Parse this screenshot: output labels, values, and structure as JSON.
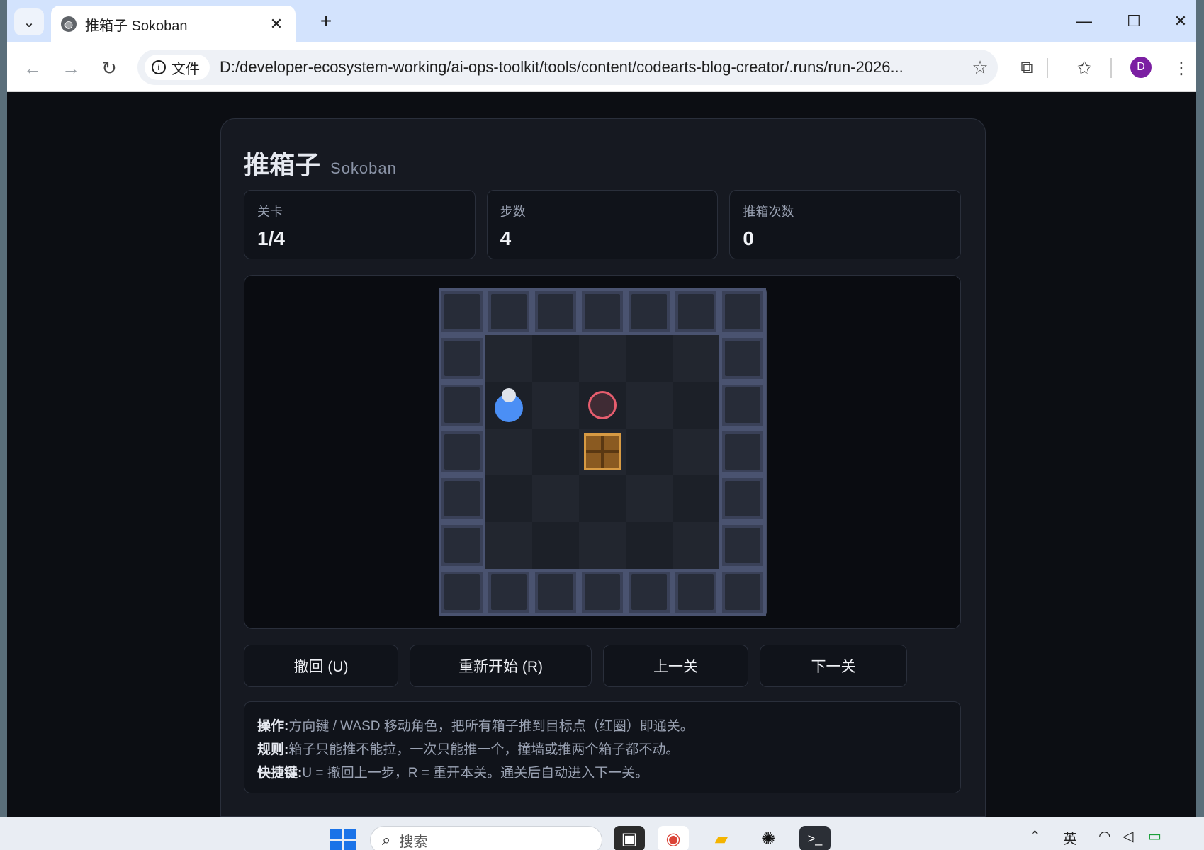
{
  "browser": {
    "tab_title": "推箱子 Sokoban",
    "new_tab": "+",
    "site_chip": "文件",
    "url": "D:/developer-ecosystem-working/ai-ops-toolkit/tools/content/codearts-blog-creator/.runs/run-2026...",
    "profile_initial": "D"
  },
  "game": {
    "title": "推箱子",
    "subtitle": "Sokoban",
    "stats": [
      {
        "label": "关卡",
        "value": "1/4"
      },
      {
        "label": "步数",
        "value": "4"
      },
      {
        "label": "推箱次数",
        "value": "0"
      }
    ],
    "map": [
      "#######",
      "#     #",
      "#@ .  #",
      "#  $  #",
      "#     #",
      "#     #",
      "#######"
    ],
    "buttons": {
      "undo": "撤回 (U)",
      "restart": "重新开始 (R)",
      "prev": "上一关",
      "next": "下一关"
    },
    "help": [
      {
        "label": "操作:",
        "text": "方向键 / WASD 移动角色，把所有箱子推到目标点（红圈）即通关。"
      },
      {
        "label": "规则:",
        "text": "箱子只能推不能拉，一次只能推一个，撞墙或推两个箱子都不动。"
      },
      {
        "label": "快捷键:",
        "text": "U = 撤回上一步，R = 重开本关。通关后自动进入下一关。"
      }
    ],
    "colors": {
      "player": "#4b8ff5",
      "target": "#e65d6e",
      "box": "#8a5a21",
      "wall": "#3a4158"
    }
  },
  "taskbar": {
    "search_placeholder": "搜索",
    "ime": "英"
  }
}
